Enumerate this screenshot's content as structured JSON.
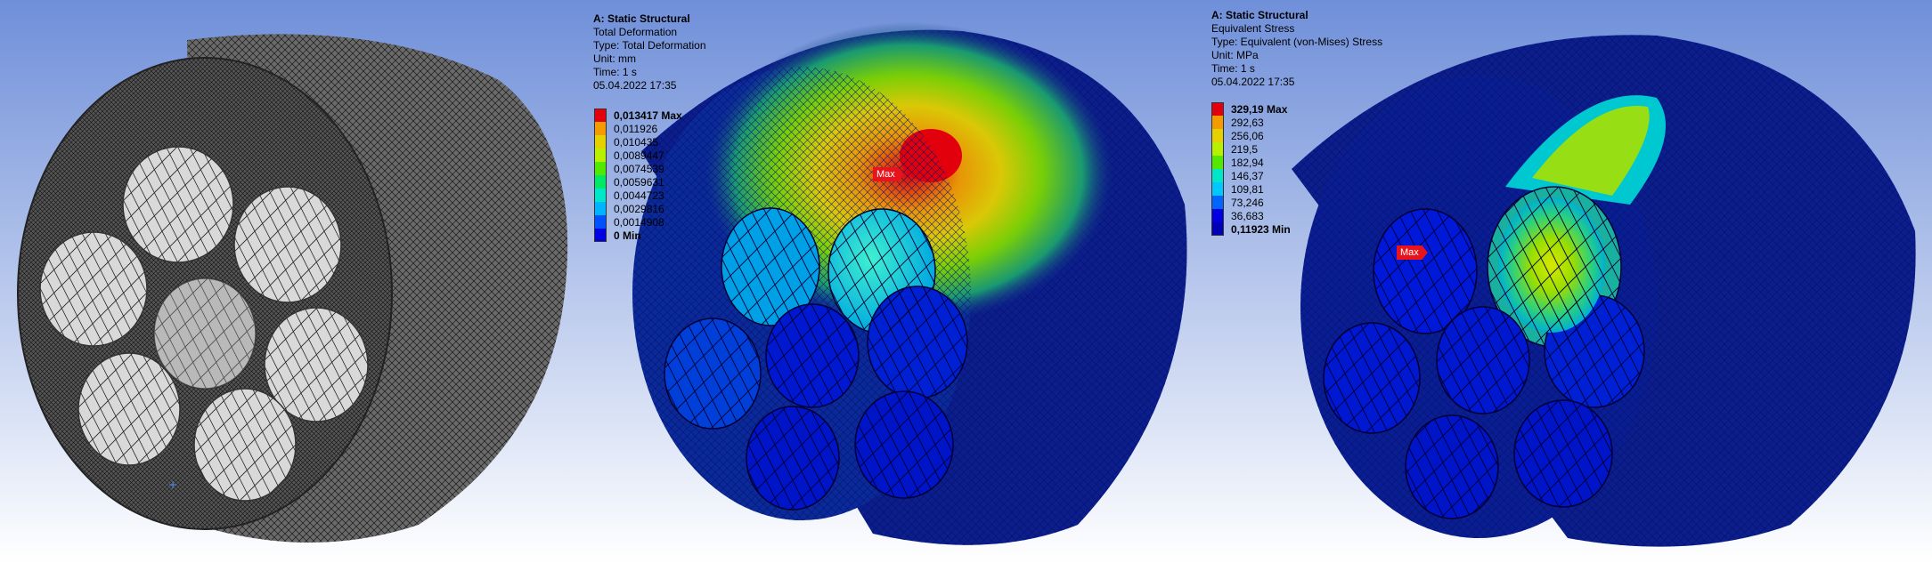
{
  "colors": {
    "background_top": "#6f8fd9",
    "background_bottom": "#ffffff",
    "mesh_face": "#6b6b6b",
    "mesh_hole": "#d8d8d8",
    "flag": "#e8141c"
  },
  "icons": {
    "mesh_model": "meshed-cylinder-icon",
    "max_probe": "max-flag-icon",
    "triad": "crosshair-icon"
  },
  "deformation": {
    "title": "A: Static Structural",
    "result": "Total Deformation",
    "type": "Type: Total Deformation",
    "unit": "Unit: mm",
    "time": "Time: 1 s",
    "date": "05.04.2022 17:35",
    "legend": [
      {
        "label": "0,013417 Max",
        "color": "#e2000c",
        "bold": true
      },
      {
        "label": "0,011926",
        "color": "#f49b00"
      },
      {
        "label": "0,010435",
        "color": "#e5d100"
      },
      {
        "label": "0,0089447",
        "color": "#b9f000"
      },
      {
        "label": "0,0074539",
        "color": "#52e800"
      },
      {
        "label": "0,0059631",
        "color": "#00e865"
      },
      {
        "label": "0,0044723",
        "color": "#00e6c8"
      },
      {
        "label": "0,0029816",
        "color": "#00b4ff"
      },
      {
        "label": "0,0014908",
        "color": "#0050ff"
      },
      {
        "label": "0 Min",
        "color": "#0000e0",
        "bold": true
      }
    ],
    "max_flag": "Max"
  },
  "stress": {
    "title": "A: Static Structural",
    "result": "Equivalent Stress",
    "type": "Type: Equivalent (von-Mises) Stress",
    "unit": "Unit: MPa",
    "time": "Time: 1 s",
    "date": "05.04.2022 17:35",
    "legend": [
      {
        "label": "329,19 Max",
        "color": "#e2000c",
        "bold": true
      },
      {
        "label": "292,63",
        "color": "#f49b00"
      },
      {
        "label": "256,06",
        "color": "#e5d100"
      },
      {
        "label": "219,5",
        "color": "#b9f000"
      },
      {
        "label": "182,94",
        "color": "#52e800"
      },
      {
        "label": "146,37",
        "color": "#00e6c8"
      },
      {
        "label": "109,81",
        "color": "#00c8ff"
      },
      {
        "label": "73,246",
        "color": "#0064ff"
      },
      {
        "label": "36,683",
        "color": "#0000e0"
      },
      {
        "label": "0,11923 Min",
        "color": "#0000b4",
        "bold": true
      }
    ],
    "max_flag": "Max"
  }
}
